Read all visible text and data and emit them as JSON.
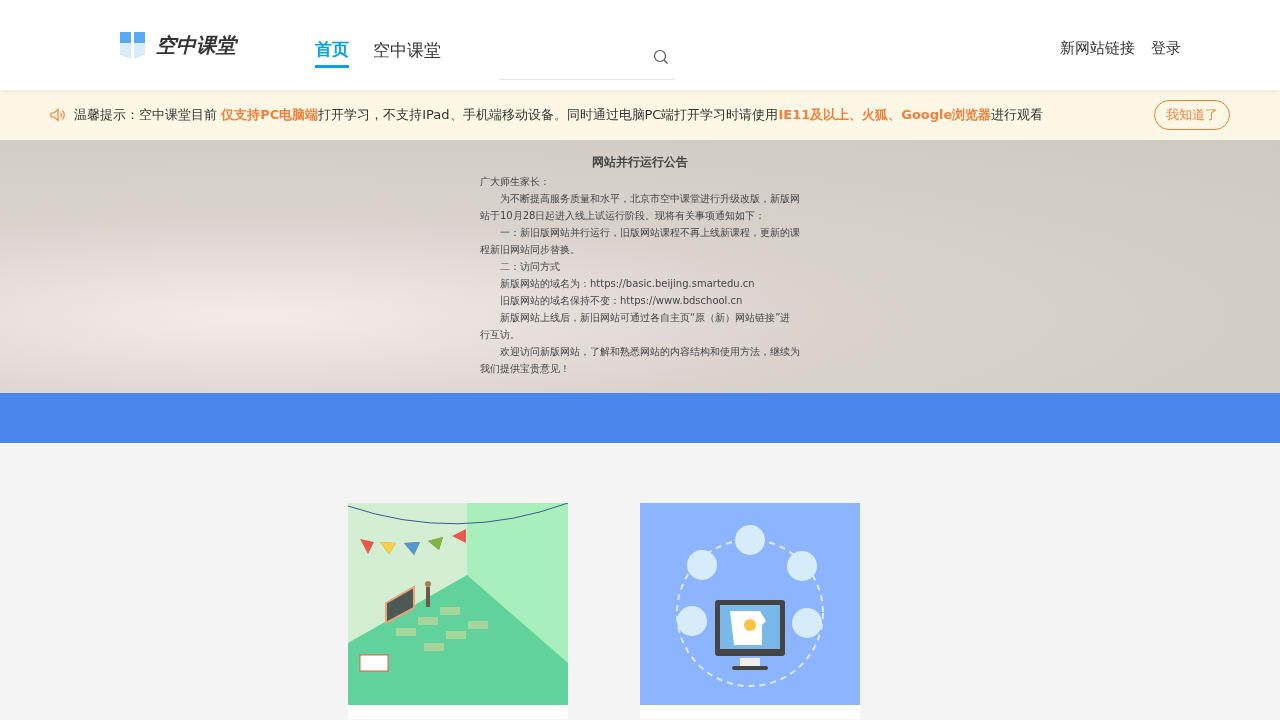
{
  "header": {
    "logo_text": "空中课堂",
    "nav": [
      {
        "label": "首页",
        "selected": true
      },
      {
        "label": "空中课堂",
        "selected": false
      }
    ],
    "links": [
      "新网站链接",
      "登录"
    ]
  },
  "notice": {
    "text": "温馨提示：空中课堂目前 **仅支持PC电脑端**打开学习，不支持IPad、手机端移动设备。同时通过电脑PC端打开学习时请使用**IE11及以上、火狐、Google浏览器**进行观看",
    "button": "我知道了"
  },
  "banner": {
    "title": "网站并行运行公告",
    "paragraphs": [
      {
        "kind": "salutation",
        "text": "广大师生家长："
      },
      {
        "kind": "paragraph",
        "text": "为不断提高服务质量和水平，北京市空中课堂进行升级改版，新版网站于10月28日起进入线上试运行阶段。现将有关事项通知如下："
      },
      {
        "kind": "paragraph",
        "text": "一：新旧版网站并行运行，旧版网站课程不再上线新课程，更新的课程新旧网站同步替换。"
      },
      {
        "kind": "paragraph",
        "text": "二：访问方式"
      },
      {
        "kind": "paragraph",
        "text": "新版网站的域名为：https://basic.beijing.smartedu.cn"
      },
      {
        "kind": "paragraph",
        "text": "旧版网站的域名保持不变：https://www.bdschool.cn"
      },
      {
        "kind": "paragraph",
        "text": "新版网站上线后，新旧网站可通过各自主页“原（新）网站链接”进行互访。"
      },
      {
        "kind": "paragraph",
        "text": "欢迎访问新版网站，了解和熟悉网站的内容结构和使用方法，继续为我们提供宝贵意见！"
      }
    ]
  },
  "cards": [
    {
      "kind": "classroom"
    },
    {
      "kind": "online"
    }
  ]
}
